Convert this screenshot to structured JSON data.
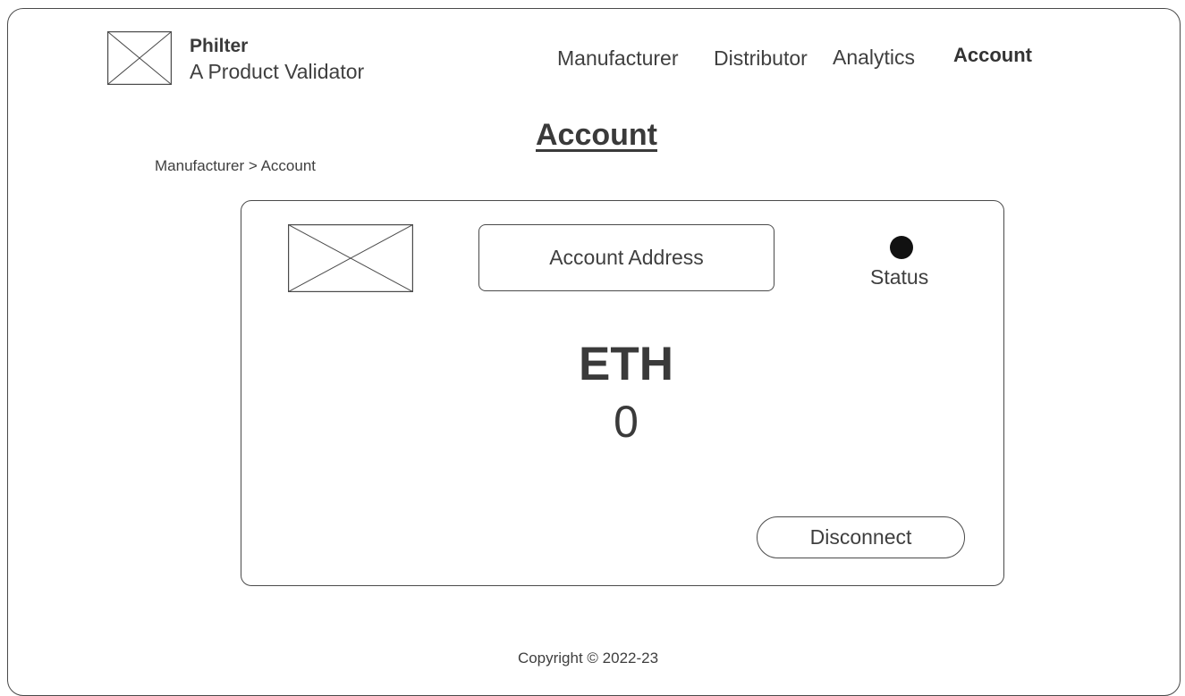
{
  "header": {
    "brand_name": "Philter",
    "brand_tagline": "A Product Validator",
    "nav": {
      "manufacturer": "Manufacturer",
      "distributor": "Distributor",
      "analytics": "Analytics",
      "account": "Account"
    }
  },
  "page": {
    "title": "Account",
    "breadcrumb": "Manufacturer > Account"
  },
  "account_card": {
    "address_label": "Account Address",
    "status_label": "Status",
    "status_color": "#111111",
    "currency": "ETH",
    "balance": "0",
    "disconnect_label": "Disconnect"
  },
  "footer": {
    "copyright": "Copyright © 2022-23"
  }
}
